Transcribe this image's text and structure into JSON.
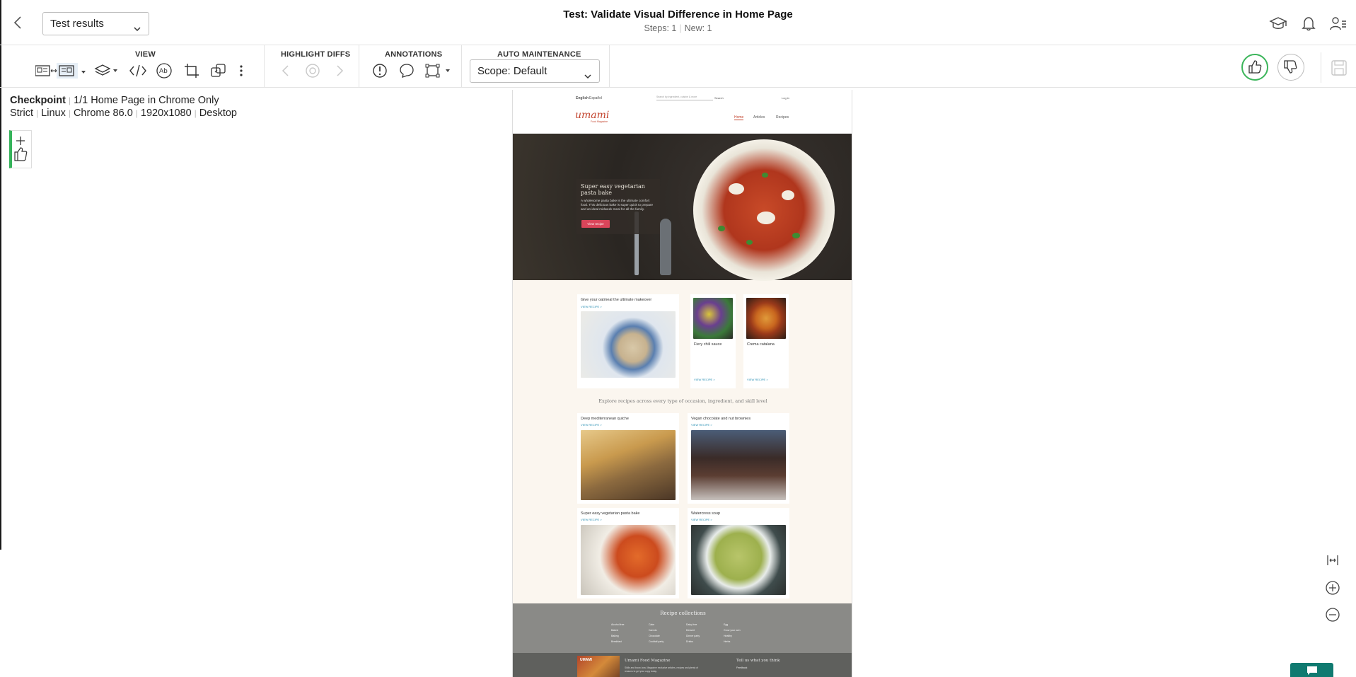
{
  "header": {
    "dropdown_value": "Test results",
    "title": "Test: Validate Visual Difference in Home Page",
    "steps": "Steps: 1",
    "new": "New: 1",
    "sep": "|"
  },
  "toolbar": {
    "view_label": "VIEW",
    "highlight_label": "HIGHLIGHT DIFFS",
    "annotations_label": "ANNOTATIONS",
    "auto_label": "AUTO MAINTENANCE",
    "scope_value": "Scope: Default"
  },
  "checkpoint": {
    "label": "Checkpoint",
    "name": "1/1 Home Page in Chrome Only",
    "match_level": "Strict",
    "os": "Linux",
    "browser": "Chrome 86.0",
    "viewport": "1920x1080",
    "device": "Desktop",
    "pipe": "|"
  },
  "screenshot": {
    "lang_en": "English",
    "lang_es": "Español",
    "search_placeholder": "Search by ingredient, cuisine & more",
    "search_btn": "Search",
    "login": "Log in",
    "logo": "umami",
    "logo_sub": "Food Magazine",
    "nav": [
      "Home",
      "Articles",
      "Recipes"
    ],
    "hero_title": "Super easy vegetarian pasta bake",
    "hero_text": "A wholesome pasta bake is the ultimate comfort food. This delicious bake is super quick to prepare and an ideal midweek meal for all the family.",
    "hero_button": "View recipe",
    "card1_title": "Give your oatmeal the ultimate makeover",
    "view_recipe": "VIEW RECIPE >",
    "card2_title": "Fiery chili sauce",
    "card3_title": "Crema catalana",
    "explore": "Explore recipes across every type of occasion, ingredient, and skill level",
    "grid": [
      {
        "title": "Deep mediterranean quiche"
      },
      {
        "title": "Vegan chocolate and nut brownies"
      },
      {
        "title": "Super easy vegetarian pasta bake"
      },
      {
        "title": "Watercress soup"
      }
    ],
    "collections_title": "Recipe collections",
    "collections": [
      "Alcohol free",
      "Baked",
      "Baking",
      "Breakfast",
      "Cake",
      "Carrots",
      "Chocolate",
      "Cocktail party",
      "Dairy-free",
      "Dessert",
      "Dinner party",
      "Drinks",
      "Egg",
      "Grow your own",
      "Healthy",
      "Herbs"
    ],
    "footer_mag": "Umami Food Magazine",
    "footer_mag_text": "Skills and know-how. Magazine exclusive articles, recipes and plenty of reasons to get your copy today.",
    "footer_tell": "Tell us what you think",
    "footer_feedback": "Feedback",
    "mag_cover": "UMAMI"
  }
}
